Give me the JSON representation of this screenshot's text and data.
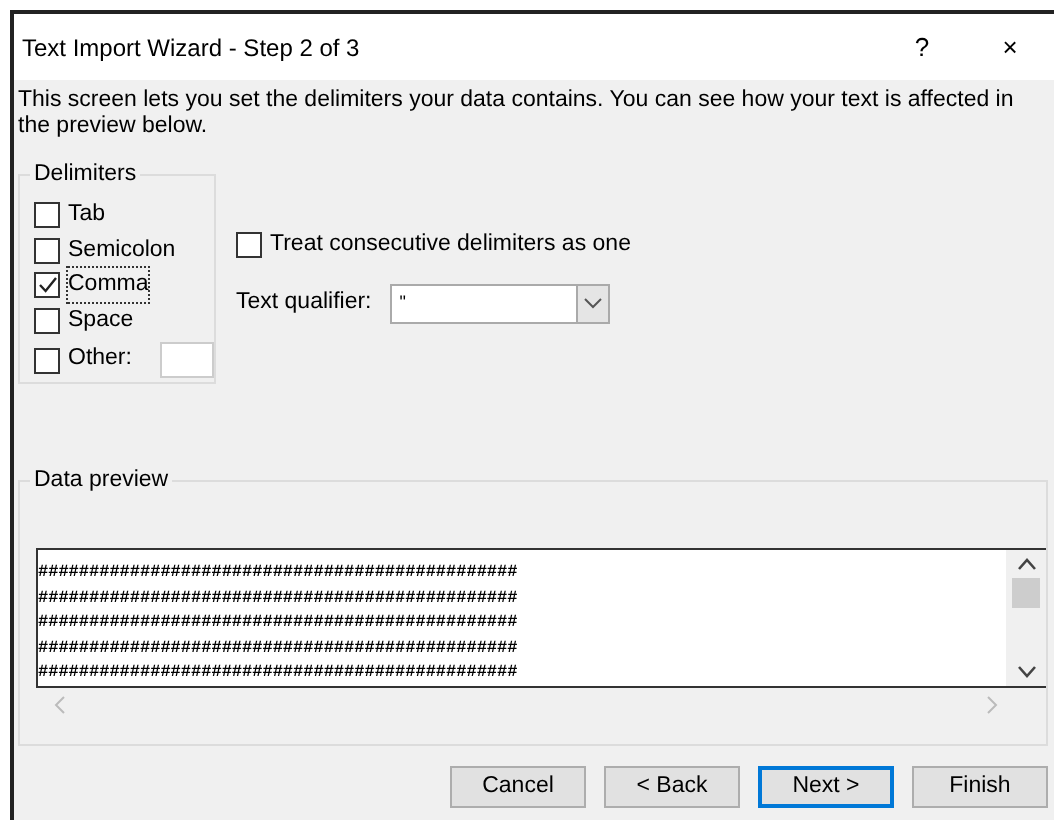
{
  "window": {
    "title": "Text Import Wizard - Step 2 of 3",
    "help": "?",
    "close": "×"
  },
  "description": "This screen lets you set the delimiters your data contains.  You can see how your text is affected in the preview below.",
  "delimiters": {
    "label": "Delimiters",
    "options": [
      {
        "label": "Tab",
        "checked": false,
        "kind": "plain"
      },
      {
        "label": "Semicolon",
        "checked": false,
        "kind": "plain"
      },
      {
        "label": "Comma",
        "checked": true,
        "kind": "plain"
      },
      {
        "label": "Space",
        "checked": false,
        "kind": "plain"
      },
      {
        "label": "Other:",
        "checked": false,
        "kind": "other"
      }
    ]
  },
  "treat_consecutive": {
    "label": "Treat consecutive delimiters as one",
    "checked": false
  },
  "text_qualifier": {
    "label": "Text qualifier:",
    "value": "\""
  },
  "data_preview": {
    "label": "Data preview",
    "rows": [
      "###############################################",
      "###############################################",
      "###############################################",
      "###############################################",
      "###############################################"
    ]
  },
  "buttons": [
    {
      "label": "Cancel",
      "default": false
    },
    {
      "label": "< Back",
      "default": false
    },
    {
      "label": "Next >",
      "default": true
    },
    {
      "label": "Finish",
      "default": false
    }
  ]
}
